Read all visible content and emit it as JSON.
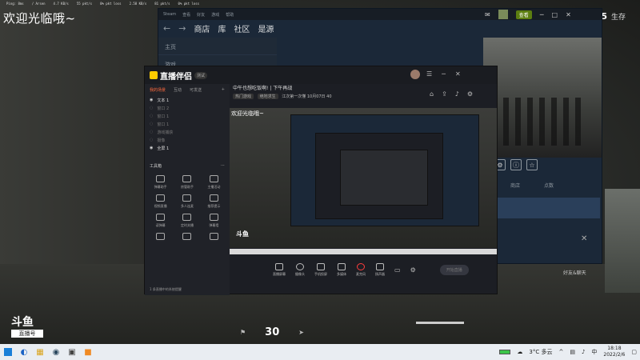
{
  "hud": {
    "stats": [
      "Ping: 8ms",
      "/ Arsen",
      "4.7 KB/s",
      "55 pkt/s",
      "0% pkt loss",
      "2.58 KB/s",
      "81 pkt/s",
      "0% pkt loss"
    ],
    "welcome": "欢迎光临哦~",
    "survive_count": "15",
    "survive_label": "生存",
    "logo_main": "斗鱼",
    "logo_sub": "直播号",
    "ammo": "30"
  },
  "steam": {
    "menu": [
      "Steam",
      "查看",
      "好友",
      "游戏",
      "帮助"
    ],
    "nav": [
      "商店",
      "库",
      "社区",
      "是源"
    ],
    "sidebar": [
      "主页",
      "游戏"
    ],
    "tabs": [
      "商店",
      "点数"
    ],
    "friends": "好友&聊天",
    "user_badge": "查看"
  },
  "live": {
    "brand": "直播伴侣",
    "version": "测试",
    "room_title": "中午也想吃饭啊! | 下午再战",
    "room_tags": [
      "热门游戏",
      "绝地求生",
      "江次第一次懂",
      "10月07日",
      "40"
    ],
    "left_tabs": [
      "我的场景",
      "互动",
      "可发送"
    ],
    "scenes": [
      "文本 1",
      "窗口 2",
      "窗口 1",
      "窗口 1",
      "游戏捕获",
      "摄像",
      "全屏 1"
    ],
    "toolbox_label": "工具箱",
    "tools": [
      "弹幕助手",
      "房管助手",
      "主播活动",
      "视频直播",
      "多人连麦",
      "推荐提示",
      "读弹幕",
      "定时关播",
      "弹幕墙",
      "",
      "",
      ""
    ],
    "notice": "1 条直播中的系统提醒",
    "preview_welcome": "欢迎光临哦~",
    "controls": [
      "直播屏幕",
      "摄像头",
      "手机投屏",
      "多媒体",
      "麦克风",
      "扬声器"
    ],
    "start_button": "开始直播"
  },
  "taskbar": {
    "weather": "3°C 多云",
    "time": "18:18",
    "date": "2022/2/6",
    "ime": "中"
  }
}
